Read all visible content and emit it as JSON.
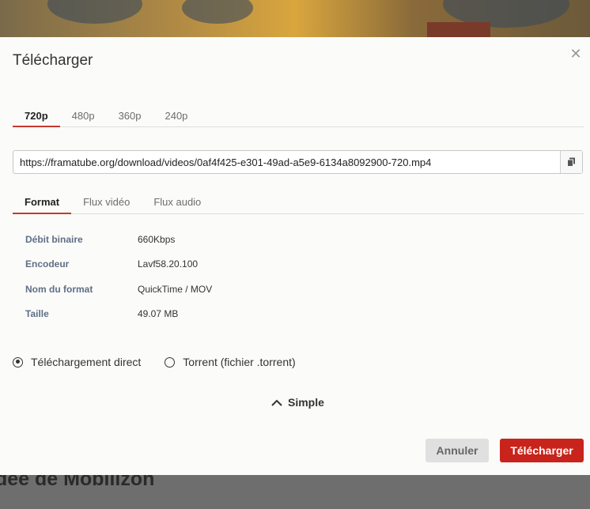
{
  "background": {
    "page_title_partial": "dee de Mobilizon"
  },
  "modal": {
    "title": "Télécharger",
    "close_icon": "close-icon",
    "resolution_tabs": [
      {
        "label": "720p",
        "active": true
      },
      {
        "label": "480p",
        "active": false
      },
      {
        "label": "360p",
        "active": false
      },
      {
        "label": "240p",
        "active": false
      }
    ],
    "url": {
      "value": "https://framatube.org/download/videos/0af4f425-e301-49ad-a5e9-6134a8092900-720.mp4",
      "copy_icon": "copy-icon"
    },
    "info_tabs": [
      {
        "label": "Format",
        "active": true
      },
      {
        "label": "Flux vidéo",
        "active": false
      },
      {
        "label": "Flux audio",
        "active": false
      }
    ],
    "metadata": [
      {
        "key": "Débit binaire",
        "value": "660Kbps"
      },
      {
        "key": "Encodeur",
        "value": "Lavf58.20.100"
      },
      {
        "key": "Nom du format",
        "value": "QuickTime / MOV"
      },
      {
        "key": "Taille",
        "value": "49.07 MB"
      }
    ],
    "download_type": [
      {
        "label": "Téléchargement direct",
        "checked": true
      },
      {
        "label": "Torrent (fichier .torrent)",
        "checked": false
      }
    ],
    "advanced_toggle": "Simple",
    "buttons": {
      "cancel": "Annuler",
      "download": "Télécharger"
    },
    "colors": {
      "accent": "#c8241b",
      "tab_underline": "#c43a2c"
    }
  }
}
